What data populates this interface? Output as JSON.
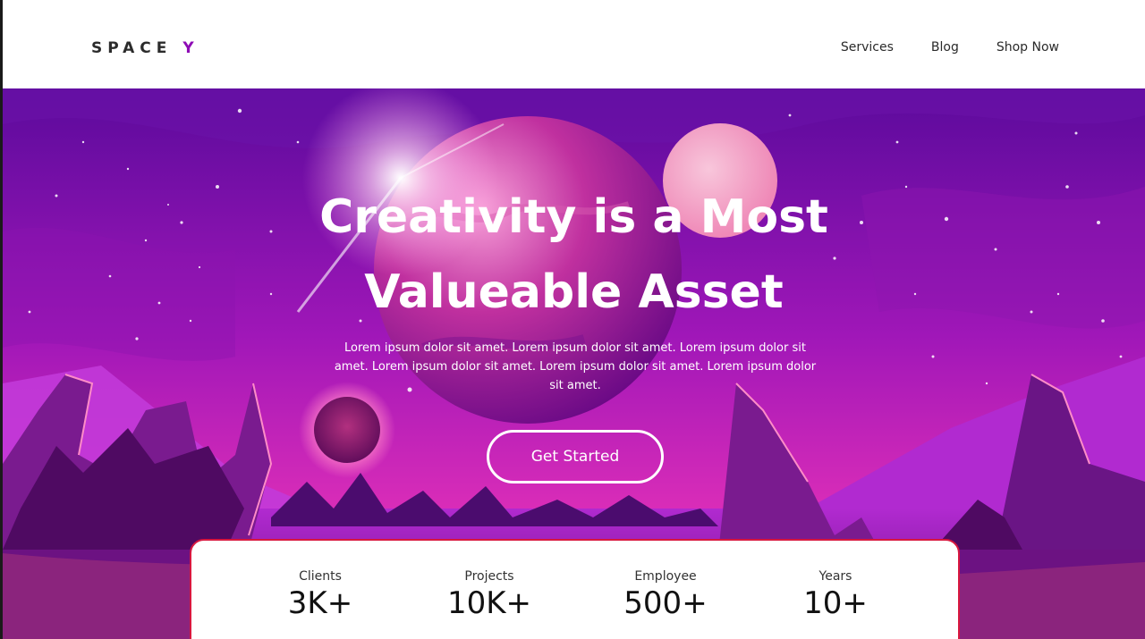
{
  "brand": {
    "name": "SPACE",
    "accent_letter": "Y"
  },
  "nav": {
    "items": [
      "Services",
      "Blog",
      "Shop Now"
    ]
  },
  "hero": {
    "title_line1": "Creativity is a Most",
    "title_line2": "Valueable Asset",
    "description": "Lorem ipsum dolor sit amet. Lorem ipsum dolor sit amet. Lorem ipsum dolor sit amet. Lorem ipsum dolor sit amet. Lorem ipsum dolor sit amet. Lorem ipsum dolor sit amet.",
    "cta_label": "Get Started"
  },
  "stats": [
    {
      "label": "Clients",
      "value": "3K+"
    },
    {
      "label": "Projects",
      "value": "10K+"
    },
    {
      "label": "Employee",
      "value": "500+"
    },
    {
      "label": "Years",
      "value": "10+"
    }
  ],
  "colors": {
    "brand_accent": "#8e0bb5",
    "hero_sky_top": "#5b0a9c",
    "hero_sky_bottom": "#e02fb8",
    "stats_border": "#d8173f"
  }
}
